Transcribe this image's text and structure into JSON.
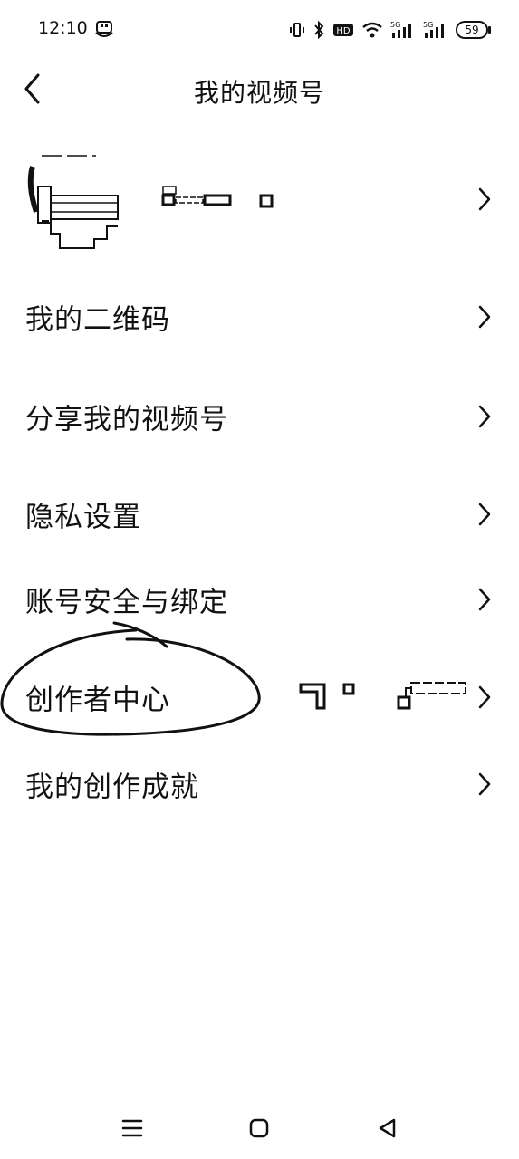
{
  "status_bar": {
    "time": "12:10",
    "battery": "59",
    "network_labels": [
      "HD",
      "5G",
      "5G"
    ],
    "icons": [
      "app-notification-icon",
      "vibrate-icon",
      "bluetooth-icon",
      "hd-icon",
      "wifi-icon",
      "signal-5g-icon",
      "signal-5g-icon",
      "battery-icon"
    ]
  },
  "header": {
    "title": "我的视频号",
    "back_icon": "chevron-left-icon"
  },
  "profile": {
    "avatar_icon": "avatar",
    "name_redacted": true,
    "chevron_icon": "chevron-right-icon"
  },
  "menu": {
    "items": [
      {
        "label": "我的二维码"
      },
      {
        "label": "分享我的视频号"
      },
      {
        "label": "隐私设置"
      },
      {
        "label": "账号安全与绑定"
      },
      {
        "label": "创作者中心",
        "highlighted": true,
        "has_redacted_extra": true
      },
      {
        "label": "我的创作成就"
      }
    ]
  },
  "bottom_nav": {
    "icons": [
      "menu-icon",
      "home-icon",
      "back-triangle-icon"
    ]
  },
  "colors": {
    "background": "#ffffff",
    "text": "#111111",
    "annotation": "#111111"
  }
}
